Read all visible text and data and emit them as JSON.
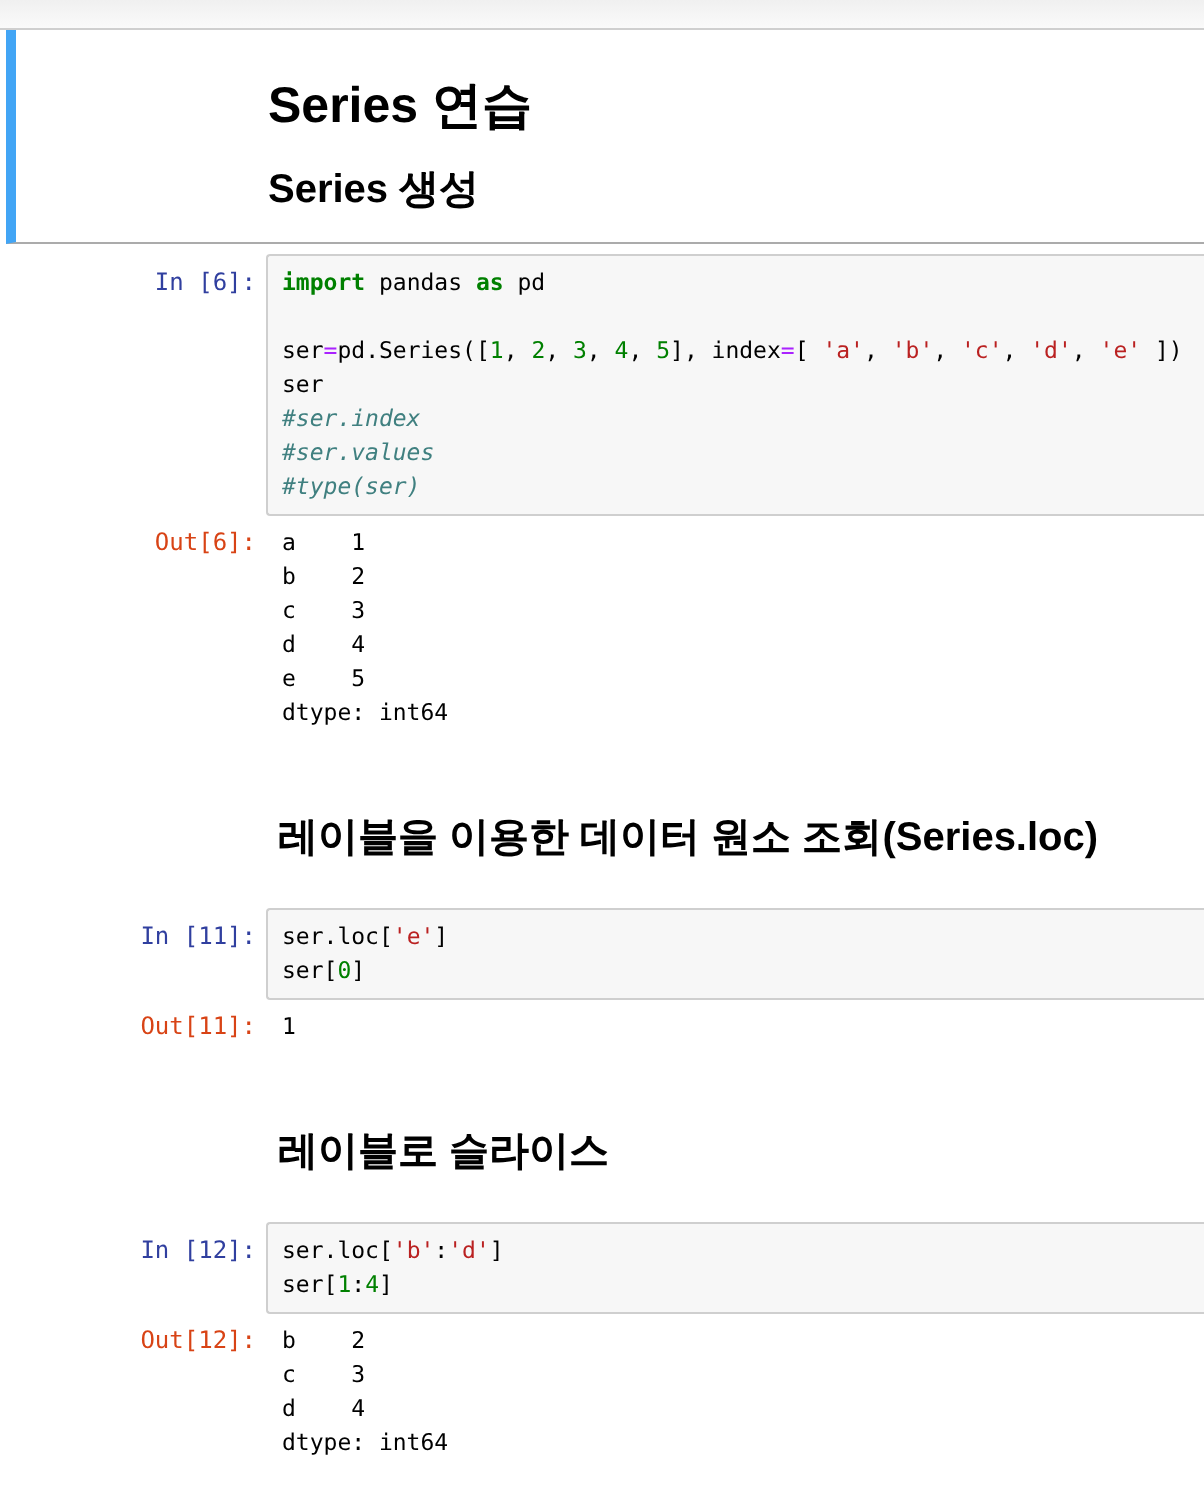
{
  "cells": [
    {
      "kind": "markdown",
      "selected": true,
      "headings": [
        {
          "kind": "h1",
          "text": "Series 연습"
        },
        {
          "kind": "h2",
          "text": "Series 생성"
        }
      ]
    },
    {
      "kind": "code",
      "selected": false,
      "prompt": "In [6]:",
      "lines": [
        {
          "kind": "code",
          "tokens": [
            {
              "kind": "keyword",
              "text": "import"
            },
            {
              "kind": "plain",
              "text": " pandas "
            },
            {
              "kind": "keyword",
              "text": "as"
            },
            {
              "kind": "plain",
              "text": " pd"
            }
          ]
        },
        {
          "kind": "blank"
        },
        {
          "kind": "code",
          "tokens": [
            {
              "kind": "plain",
              "text": "ser"
            },
            {
              "kind": "operator",
              "text": "="
            },
            {
              "kind": "plain",
              "text": "pd.Series(["
            },
            {
              "kind": "number",
              "text": "1"
            },
            {
              "kind": "plain",
              "text": ", "
            },
            {
              "kind": "number",
              "text": "2"
            },
            {
              "kind": "plain",
              "text": ", "
            },
            {
              "kind": "number",
              "text": "3"
            },
            {
              "kind": "plain",
              "text": ", "
            },
            {
              "kind": "number",
              "text": "4"
            },
            {
              "kind": "plain",
              "text": ", "
            },
            {
              "kind": "number",
              "text": "5"
            },
            {
              "kind": "plain",
              "text": "], index"
            },
            {
              "kind": "operator",
              "text": "="
            },
            {
              "kind": "plain",
              "text": "[ "
            },
            {
              "kind": "string",
              "text": "'a'"
            },
            {
              "kind": "plain",
              "text": ", "
            },
            {
              "kind": "string",
              "text": "'b'"
            },
            {
              "kind": "plain",
              "text": ", "
            },
            {
              "kind": "string",
              "text": "'c'"
            },
            {
              "kind": "plain",
              "text": ", "
            },
            {
              "kind": "string",
              "text": "'d'"
            },
            {
              "kind": "plain",
              "text": ", "
            },
            {
              "kind": "string",
              "text": "'e'"
            },
            {
              "kind": "plain",
              "text": " ])"
            }
          ]
        },
        {
          "kind": "code",
          "tokens": [
            {
              "kind": "plain",
              "text": "ser"
            }
          ]
        },
        {
          "kind": "code",
          "tokens": [
            {
              "kind": "comment",
              "text": "#ser.index"
            }
          ]
        },
        {
          "kind": "code",
          "tokens": [
            {
              "kind": "comment",
              "text": "#ser.values"
            }
          ]
        },
        {
          "kind": "code",
          "tokens": [
            {
              "kind": "comment",
              "text": "#type(ser)"
            }
          ]
        }
      ],
      "output": {
        "prompt": "Out[6]:",
        "lines": [
          "a    1",
          "b    2",
          "c    3",
          "d    4",
          "e    5",
          "dtype: int64"
        ]
      }
    },
    {
      "kind": "markdown",
      "selected": false,
      "headings": [
        {
          "kind": "h2",
          "text": "레이블을 이용한 데이터 원소 조회(Series.loc)"
        }
      ]
    },
    {
      "kind": "code",
      "selected": false,
      "prompt": "In [11]:",
      "lines": [
        {
          "kind": "code",
          "tokens": [
            {
              "kind": "plain",
              "text": "ser.loc["
            },
            {
              "kind": "string",
              "text": "'e'"
            },
            {
              "kind": "plain",
              "text": "]"
            }
          ]
        },
        {
          "kind": "code",
          "tokens": [
            {
              "kind": "plain",
              "text": "ser["
            },
            {
              "kind": "number",
              "text": "0"
            },
            {
              "kind": "plain",
              "text": "]"
            }
          ]
        }
      ],
      "output": {
        "prompt": "Out[11]:",
        "lines": [
          "1"
        ]
      }
    },
    {
      "kind": "markdown",
      "selected": false,
      "headings": [
        {
          "kind": "h2",
          "text": "레이블로 슬라이스"
        }
      ]
    },
    {
      "kind": "code",
      "selected": false,
      "prompt": "In [12]:",
      "lines": [
        {
          "kind": "code",
          "tokens": [
            {
              "kind": "plain",
              "text": "ser.loc["
            },
            {
              "kind": "string",
              "text": "'b'"
            },
            {
              "kind": "plain",
              "text": ":"
            },
            {
              "kind": "string",
              "text": "'d'"
            },
            {
              "kind": "plain",
              "text": "]"
            }
          ]
        },
        {
          "kind": "code",
          "tokens": [
            {
              "kind": "plain",
              "text": "ser["
            },
            {
              "kind": "number",
              "text": "1"
            },
            {
              "kind": "plain",
              "text": ":"
            },
            {
              "kind": "number",
              "text": "4"
            },
            {
              "kind": "plain",
              "text": "]"
            }
          ]
        }
      ],
      "output": {
        "prompt": "Out[12]:",
        "lines": [
          "b    2",
          "c    3",
          "d    4",
          "dtype: int64"
        ]
      }
    }
  ]
}
